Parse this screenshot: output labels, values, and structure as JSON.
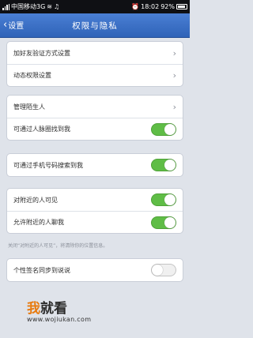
{
  "statusbar": {
    "carrier": "中国移动3G",
    "time": "18:02",
    "battery": "92%"
  },
  "navbar": {
    "back_label": "设置",
    "title": "权限与隐私"
  },
  "groups": [
    {
      "rows": [
        {
          "label": "加好友验证方式设置",
          "control": "arrow"
        },
        {
          "label": "动态权限设置",
          "control": "arrow"
        }
      ]
    },
    {
      "rows": [
        {
          "label": "管理陌生人",
          "control": "arrow"
        },
        {
          "label": "可通过人脉圈找到我",
          "control": "toggle",
          "on": true
        }
      ]
    },
    {
      "rows": [
        {
          "label": "可通过手机号码搜索到我",
          "control": "toggle",
          "on": true
        }
      ]
    },
    {
      "rows": [
        {
          "label": "对附近的人可见",
          "control": "toggle",
          "on": true
        },
        {
          "label": "允许附近的人聊我",
          "control": "toggle",
          "on": true
        }
      ]
    },
    {
      "rows": [
        {
          "label": "个性签名同步到说说",
          "control": "toggle",
          "on": false
        }
      ]
    }
  ],
  "note": "关闭“对附近的人可见”，将清除你的位置信息。",
  "watermark": {
    "logo_main": "我",
    "logo_rest": "就看",
    "url": "www.wojiukan.com"
  },
  "colors": {
    "navbar": "#3a6fc6",
    "toggle_on": "#5fbd46",
    "watermark_accent": "#e87a0e"
  }
}
